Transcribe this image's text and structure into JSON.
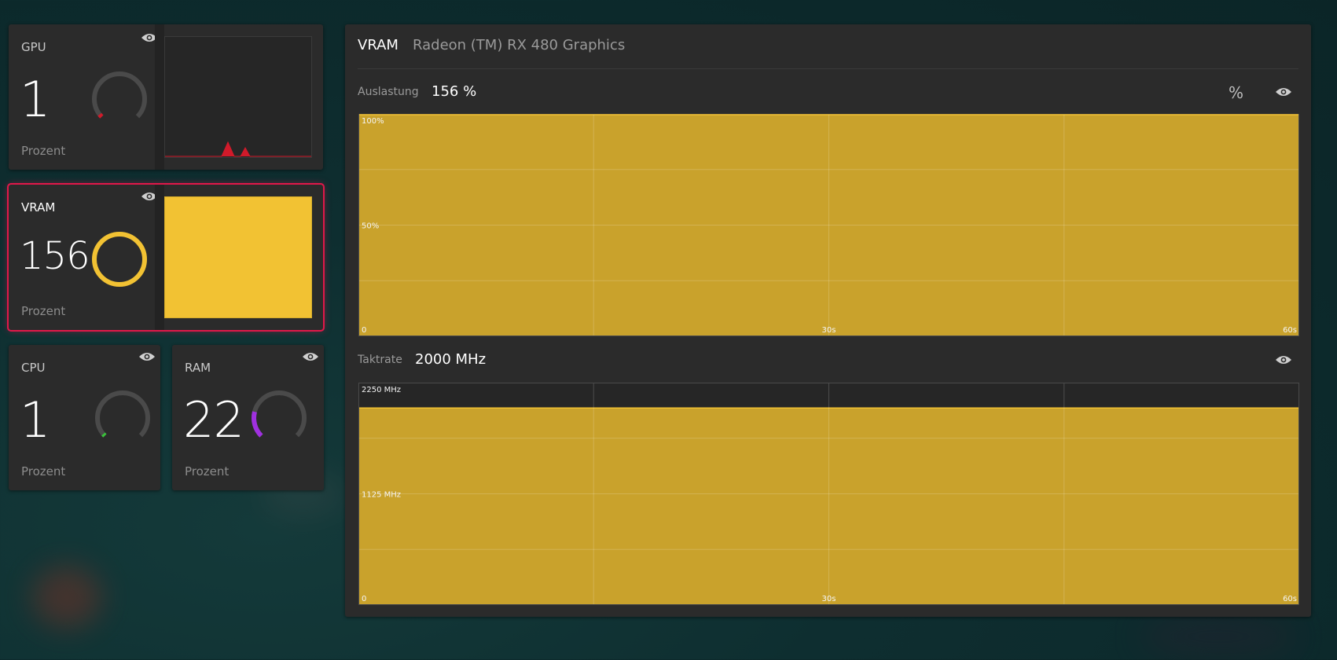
{
  "theme": {
    "accent_gold": "#c9a22c",
    "gauge_gold": "#f2c233",
    "gpu_red": "#d11a2a",
    "cpu_green": "#39c23a",
    "ram_purple": "#a030e0",
    "select_red": "#e0184a"
  },
  "tiles": {
    "gpu": {
      "title": "GPU",
      "value": "1",
      "unit": "Prozent",
      "percent": 1,
      "icon": "eye-icon"
    },
    "vram": {
      "title": "VRAM",
      "value": "156",
      "unit": "Prozent",
      "percent": 156,
      "icon": "eye-icon"
    },
    "cpu": {
      "title": "CPU",
      "value": "1",
      "unit": "Prozent",
      "percent": 1,
      "icon": "eye-icon"
    },
    "ram": {
      "title": "RAM",
      "value": "22",
      "unit": "Prozent",
      "percent": 22,
      "icon": "eye-icon"
    }
  },
  "detail": {
    "title": "VRAM",
    "device": "Radeon (TM) RX 480 Graphics",
    "usage_label": "Auslastung",
    "usage_value": "156 %",
    "usage_unit_toggle": "%",
    "clock_label": "Taktrate",
    "clock_value": "2000 MHz"
  },
  "chart_data": [
    {
      "type": "area",
      "y_ticks": [
        "100%",
        "50%"
      ],
      "x_ticks": [
        "0",
        "30s",
        "60s"
      ],
      "ylim": [
        0,
        100
      ],
      "xlim": [
        0,
        60
      ],
      "series": [
        {
          "values": [
            156,
            156,
            156,
            156,
            156,
            156,
            156
          ]
        }
      ],
      "x": [
        0,
        10,
        20,
        30,
        40,
        50,
        60
      ],
      "grid": true
    },
    {
      "type": "area",
      "y_ticks": [
        "2250 MHz",
        "1125 MHz"
      ],
      "x_ticks": [
        "0",
        "30s",
        "60s"
      ],
      "ylim": [
        0,
        2250
      ],
      "xlim": [
        0,
        60
      ],
      "series": [
        {
          "values": [
            2000,
            2000,
            2000,
            2000,
            2000,
            2000,
            2000
          ]
        }
      ],
      "x": [
        0,
        10,
        20,
        30,
        40,
        50,
        60
      ],
      "grid": true
    }
  ]
}
